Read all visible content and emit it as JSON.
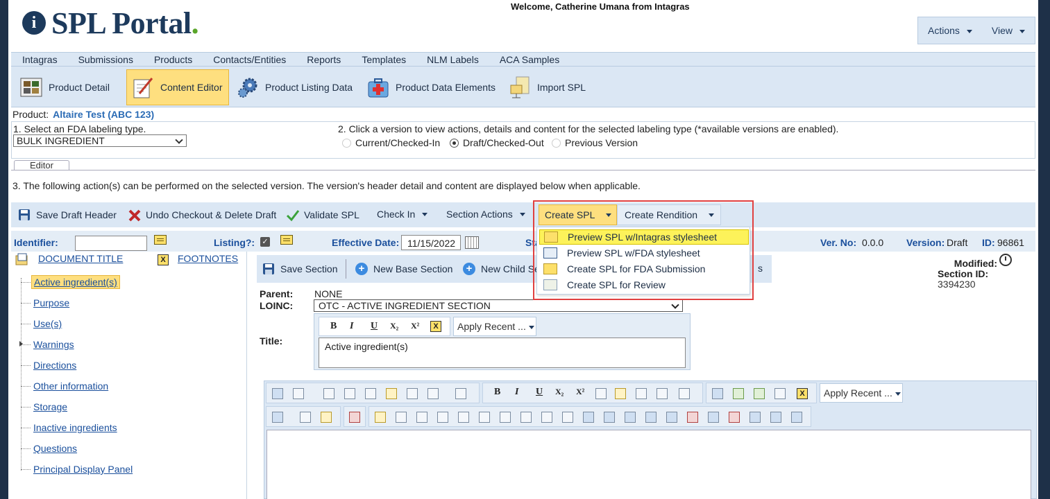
{
  "header": {
    "logo_mark": "i",
    "logo_text": "SPL Portal",
    "logo_dot": ".",
    "welcome": "Welcome, Catherine Umana from Intagras",
    "menu": [
      "Actions",
      "View"
    ]
  },
  "nav": {
    "items": [
      "Intagras",
      "Submissions",
      "Products",
      "Contacts/Entities",
      "Reports",
      "Templates",
      "NLM Labels",
      "ACA Samples"
    ]
  },
  "iconbar": {
    "buttons": [
      {
        "label": "Product Detail",
        "icon": "product-detail-icon"
      },
      {
        "label": "Content Editor",
        "icon": "content-editor-icon",
        "active": true
      },
      {
        "label": "Product Listing Data",
        "icon": "gears-icon"
      },
      {
        "label": "Product Data Elements",
        "icon": "medical-kit-icon"
      },
      {
        "label": "Import SPL",
        "icon": "import-icon"
      }
    ]
  },
  "product": {
    "label": "Product:",
    "value": "Altaire Test (ABC 123)"
  },
  "labeling": {
    "step1": "1. Select an FDA labeling type.",
    "type_value": "BULK INGREDIENT",
    "step2": "2. Click a version to view actions, details and content for the selected labeling type (*available versions are enabled).",
    "versions": [
      {
        "label": "Current/Checked-In",
        "selected": false,
        "enabled": false
      },
      {
        "label": "Draft/Checked-Out",
        "selected": true,
        "enabled": true
      },
      {
        "label": "Previous Version",
        "selected": false,
        "enabled": false
      }
    ]
  },
  "tabs": {
    "editor": "Editor"
  },
  "step3": "3. The following action(s) can be performed on the selected version. The version's header detail and content are displayed below when applicable.",
  "actions": {
    "save_draft_header": "Save Draft Header",
    "undo_checkout": "Undo Checkout & Delete Draft",
    "validate_spl": "Validate SPL",
    "check_in": "Check In",
    "section_actions": "Section Actions",
    "create_spl": "Create SPL",
    "create_rendition": "Create Rendition"
  },
  "create_spl_menu": [
    {
      "label": "Preview SPL w/Intagras stylesheet",
      "highlighted": true
    },
    {
      "label": "Preview SPL w/FDA stylesheet",
      "highlighted": false
    },
    {
      "label": "Create SPL for FDA Submission",
      "highlighted": false
    },
    {
      "label": "Create SPL for Review",
      "highlighted": false
    }
  ],
  "fields": {
    "identifier_label": "Identifier:",
    "identifier_value": "",
    "listing_label": "Listing?:",
    "listing_checked": true,
    "effective_date_label": "Effective Date:",
    "effective_date_value": "11/15/2022",
    "status_label_partial": "Sta",
    "ver_no_label": "Ver. No:",
    "ver_no_value": "0.0.0",
    "version_label": "Version:",
    "version_value": "Draft",
    "id_label": "ID:",
    "id_value": "96861"
  },
  "tree": {
    "document_title": "DOCUMENT TITLE",
    "footnotes": "FOOTNOTES",
    "sections": [
      "Active ingredient(s)",
      "Purpose",
      "Use(s)",
      "Warnings",
      "Directions",
      "Other information",
      "Storage",
      "Inactive ingredients",
      "Questions",
      "Principal Display Panel"
    ],
    "selected_index": 0
  },
  "section": {
    "save_section": "Save Section",
    "new_base_section": "New Base Section",
    "new_child_section_partial": "New Child Sec",
    "partial_right": "s",
    "modified_label": "Modified:",
    "section_id_label": "Section ID:",
    "section_id_value": "3394230",
    "parent_label": "Parent:",
    "parent_value": "NONE",
    "loinc_label": "LOINC:",
    "loinc_value": "OTC - ACTIVE INGREDIENT SECTION",
    "title_label": "Title:",
    "title_value": "Active ingredient(s)",
    "apply_recent": "Apply Recent ...",
    "format_buttons": [
      "B",
      "I",
      "U",
      "X₂",
      "X²"
    ]
  },
  "colors": {
    "brand_navy": "#1d3a5c",
    "toolbar_bg": "#dbe7f4",
    "active_yellow": "#fedf7f",
    "link_blue": "#1a4f9c",
    "highlight_outline": "#e04040"
  }
}
